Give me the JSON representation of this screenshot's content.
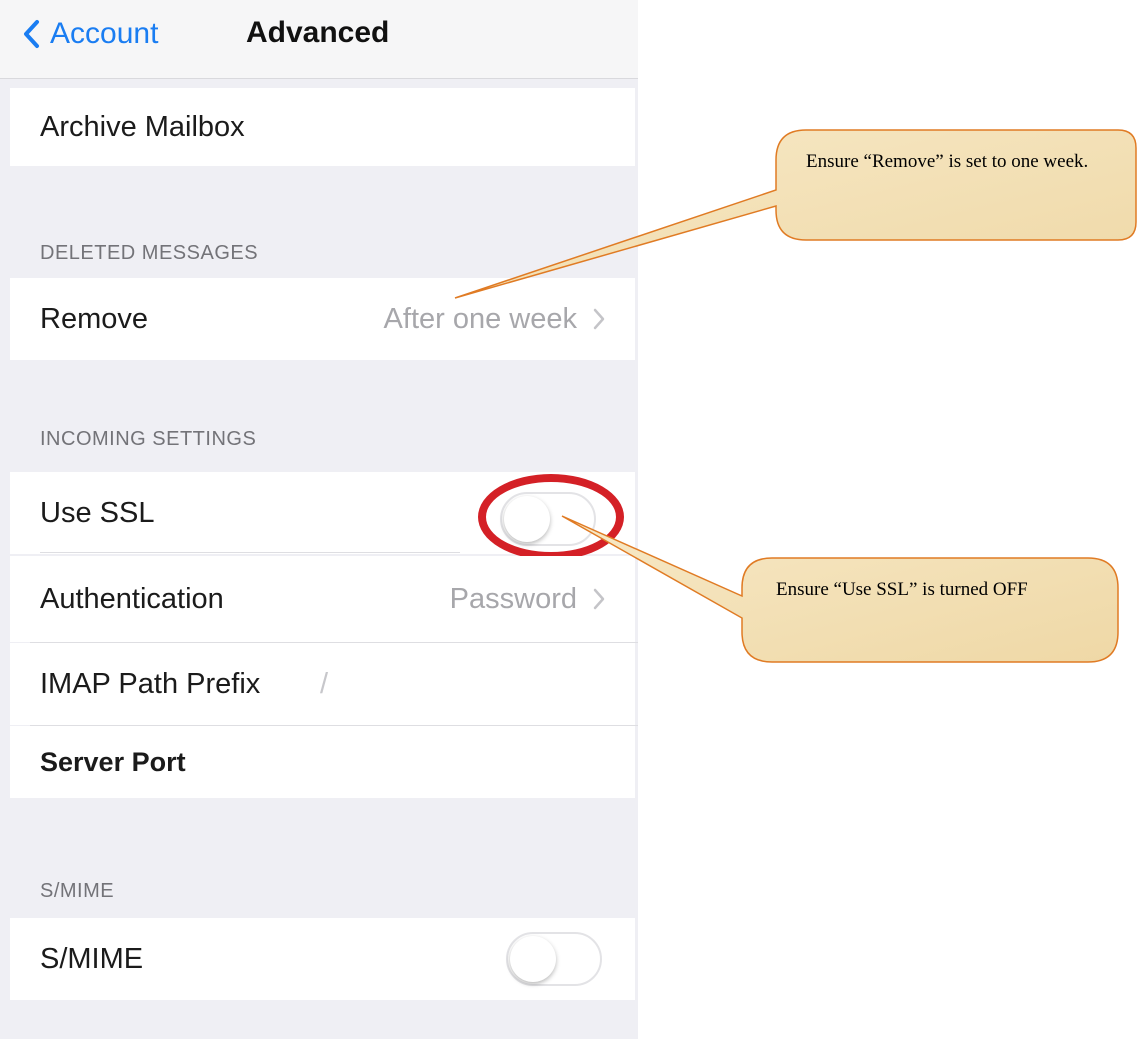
{
  "navbar": {
    "back_label": "Account",
    "title": "Advanced"
  },
  "rows": {
    "archive_mailbox": "Archive Mailbox",
    "remove": {
      "label": "Remove",
      "value": "After one week"
    },
    "use_ssl": {
      "label": "Use SSL",
      "on": false
    },
    "authentication": {
      "label": "Authentication",
      "value": "Password"
    },
    "imap_path_prefix": {
      "label": "IMAP Path Prefix",
      "value": "/"
    },
    "server_port": "Server Port",
    "smime": {
      "label": "S/MIME",
      "on": false
    }
  },
  "sections": {
    "deleted_messages": "DELETED MESSAGES",
    "incoming_settings": "INCOMING SETTINGS",
    "smime": "S/MIME"
  },
  "annotations": {
    "remove_note": "Ensure “Remove” is set to one week.",
    "ssl_note": "Ensure “Use SSL” is turned OFF"
  },
  "colors": {
    "accent": "#1a7df2",
    "highlight": "#d42026",
    "callout_fill": "#f4e1b4",
    "callout_border": "#e07b24"
  }
}
